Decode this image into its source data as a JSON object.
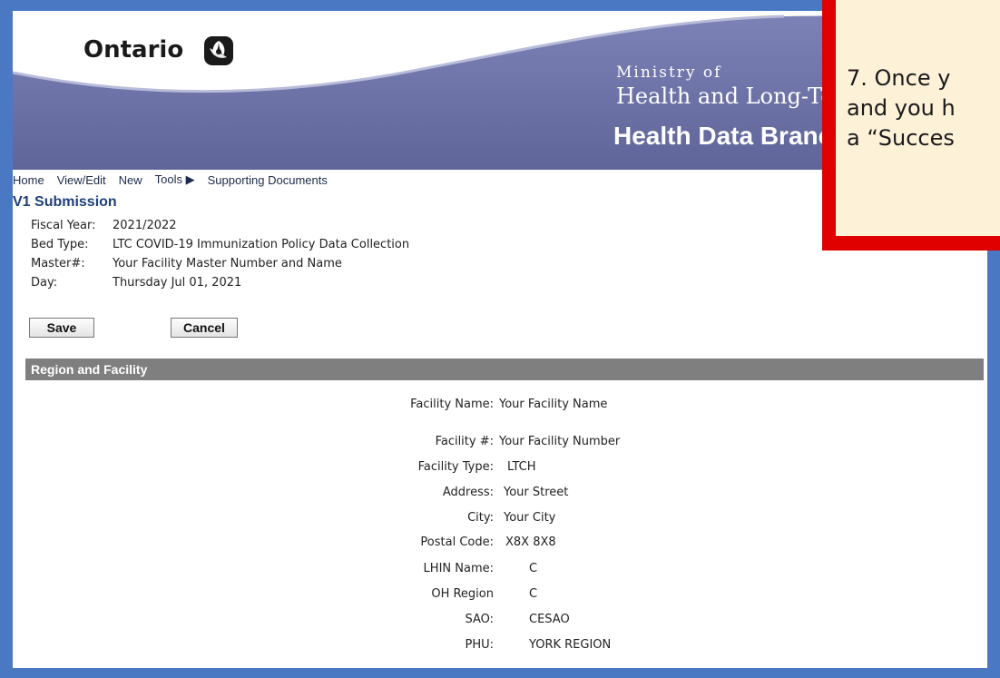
{
  "header": {
    "logo_text": "Ontario",
    "ministry_of": "Ministry of",
    "ministry_name": "Health and Long-Term Care",
    "branch_name": "Health Data Branch"
  },
  "nav": {
    "items": [
      "Home",
      "View/Edit",
      "New",
      "Tools ▶",
      "Supporting Documents"
    ]
  },
  "submission": {
    "title": "V1 Submission",
    "fields": [
      {
        "label": "Fiscal Year:",
        "value": "2021/2022"
      },
      {
        "label": "Bed Type:",
        "value": "LTC COVID-19 Immunization Policy Data Collection"
      },
      {
        "label": "Master#:",
        "value": "Your Facility Master Number and Name"
      },
      {
        "label": "Day:",
        "value": "Thursday Jul 01, 2021"
      }
    ],
    "save_label": "Save",
    "cancel_label": "Cancel"
  },
  "region": {
    "title": "Region and Facility",
    "fields": [
      {
        "label": "Facility Name:",
        "value": "Your Facility Name"
      },
      {
        "label": "Facility #:",
        "value": "Your Facility Number"
      },
      {
        "label": "Facility Type:",
        "value": "LTCH"
      },
      {
        "label": "Address:",
        "value": "Your  Street"
      },
      {
        "label": "City:",
        "value": "Your City"
      },
      {
        "label": "Postal Code:",
        "value": "X8X 8X8"
      },
      {
        "label": "LHIN Name:",
        "value": "C"
      },
      {
        "label": "OH Region",
        "value": "C"
      },
      {
        "label": "SAO:",
        "value": "CESAO"
      },
      {
        "label": "PHU:",
        "value": "YORK REGION"
      }
    ]
  },
  "callout": {
    "lines": [
      "7. Once y",
      "and you h",
      "a “Succes"
    ]
  },
  "colors": {
    "frame": "#4a78c2",
    "banner": "#6a6fa8",
    "section_bar": "#7f7f7f",
    "callout_border": "#e00000",
    "callout_fill": "#fdf1d8",
    "title_blue": "#1f3f7a"
  }
}
